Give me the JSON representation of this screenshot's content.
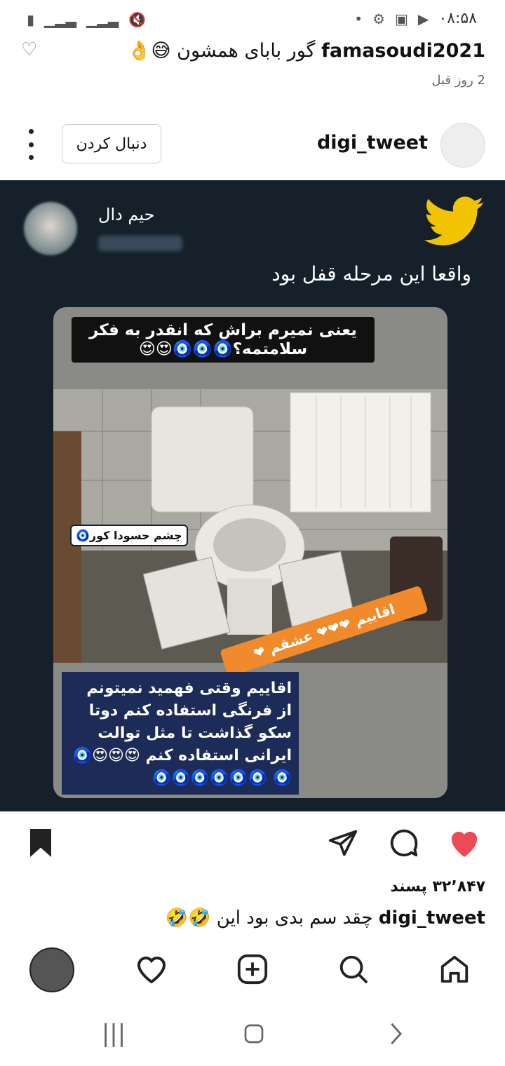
{
  "status_bar": {
    "time": "۰۸:۵۸"
  },
  "comment": {
    "username": "famasoudi2021",
    "text": "گور بابای همشون 😅👌",
    "time_ago": "2 روز قبل"
  },
  "post_header": {
    "username": "digi_tweet",
    "follow_label": "دنبال کردن"
  },
  "tweet": {
    "author_name": "حیم دال",
    "text": "واقعا این مرحله قفل بود",
    "caption_top": "یعنی نمیرم براش که انقدر به فکر سلامتمه؟🧿🧿🧿😍😍",
    "sticker_1": "چشم حسودا کور🧿",
    "sticker_2": "اقاییم ❤❤❤ عشقم ❤",
    "caption_bottom": "اقاییم وقتی فهمید نمیتونم از فرنگی استفاده کنم دوتا سکو گذاشت تا مثل توالت ایرانی استفاده کنم 😍😍😍🧿🧿 🧿🧿🧿🧿🧿🧿"
  },
  "actions": {
    "likes": "۳۲٬۸۴۷ پسند"
  },
  "caption": {
    "username": "digi_tweet",
    "text": "چقد سم بدی بود این 🤣🤣"
  },
  "colors": {
    "like_red": "#ed4956",
    "twitter_yellow": "#f2c300",
    "tweet_bg": "#15202b"
  }
}
